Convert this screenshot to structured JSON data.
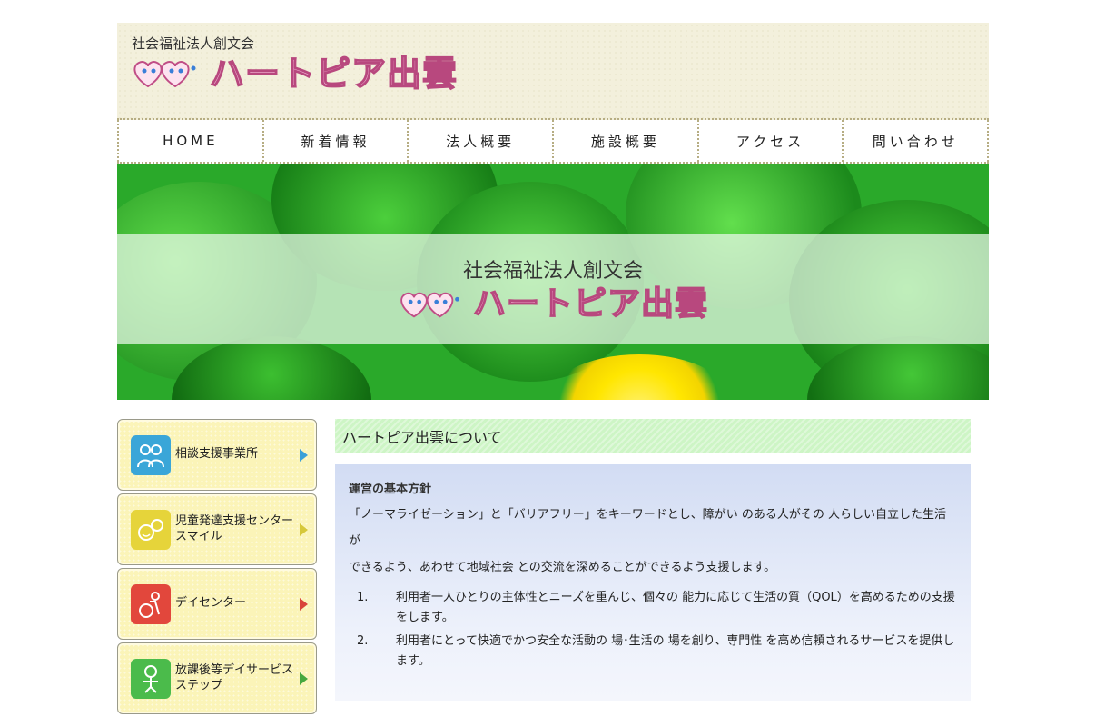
{
  "header": {
    "org_name": "社会福祉法人創文会",
    "site_title": "ハートピア出雲",
    "logo_icon": "heart-faces-icon"
  },
  "nav": {
    "items": [
      {
        "label": "HOME"
      },
      {
        "label": "新着情報"
      },
      {
        "label": "法人概要"
      },
      {
        "label": "施設概要"
      },
      {
        "label": "アクセス"
      },
      {
        "label": "問い合わせ"
      }
    ]
  },
  "hero": {
    "org_name": "社会福祉法人創文会",
    "site_title": "ハートピア出雲"
  },
  "sidebar": {
    "items": [
      {
        "label": "相談支援事業所",
        "icon": "consultation-icon",
        "icon_color": "#3aa6d8",
        "arrow_color": "#3aa0d8"
      },
      {
        "label": "児童発達支援センター\nスマイル",
        "icon": "smile-children-icon",
        "icon_color": "#e6d43a",
        "arrow_color": "#d6c83a"
      },
      {
        "label": "デイセンター",
        "icon": "wheelchair-icon",
        "icon_color": "#e2473c",
        "arrow_color": "#d9443a"
      },
      {
        "label": "放課後等デイサービス\nステップ",
        "icon": "child-step-icon",
        "icon_color": "#4bbb4b",
        "arrow_color": "#46a83e"
      }
    ]
  },
  "main": {
    "section_title": "ハートピア出雲について",
    "policy_heading": "運営の基本方針",
    "policy_intro_1": "「ノーマライゼーション」と「バリアフリー」をキーワードとし、障がい のある人がその 人らしい自立した生活が",
    "policy_intro_2": "できるよう、あわせて地域社会 との交流を深めることができるよう支援します。",
    "policies": [
      {
        "num": "1.",
        "text": "利用者一人ひとりの主体性とニーズを重んじ、個々の 能力に応じて生活の質（QOL）を高めるための支援をします。"
      },
      {
        "num": "2.",
        "text": "利用者にとって快適でかつ安全な活動の 場･生活の 場を創り、専門性 を高め信頼されるサービスを提供します。"
      }
    ]
  },
  "colors": {
    "header_bg": "#f3f0dc",
    "section_title_bg": "#cdf5c5",
    "panel_bg": "#d2dcf3",
    "logo_pink": "#f6b9d8"
  }
}
